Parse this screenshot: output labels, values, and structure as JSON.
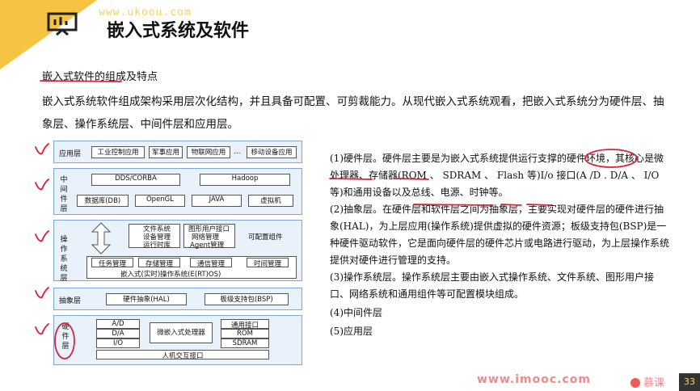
{
  "header": {
    "watermark": "www.ukoou.com",
    "title": "嵌入式系统及软件"
  },
  "subtitle": "嵌入式软件的组成及特点",
  "intro": "嵌入式系统软件组成架构采用层次化结构，并且具备可配置、可剪裁能力。从现代嵌入式系统观看，把嵌入式系统分为硬件层、抽象层、操作系统层、中间件层和应用层。",
  "diagram": {
    "app_layer": {
      "name": "应用层",
      "items": [
        "工业控制应用",
        "军事应用",
        "物联网应用",
        "…",
        "移动设备应用"
      ]
    },
    "middleware_layer": {
      "name": "中间件层",
      "top": [
        "DDS/CORBA",
        "Hadoop"
      ],
      "bottom": [
        "数据库(DB)",
        "OpenGL",
        "JAVA",
        "虚拟机"
      ]
    },
    "os_layer": {
      "name": "操作系统层",
      "col1": [
        "文件系统",
        "设备管理",
        "运行时库"
      ],
      "col2": [
        "图形用户接口",
        "网络管理",
        "Agent管理"
      ],
      "configurable": "可配置组件",
      "tasks": [
        "任务管理",
        "存储管理",
        "通信管理",
        "时间管理"
      ],
      "kernel": "嵌入式(实时)操作系统(E(RT)OS)"
    },
    "abstract_layer": {
      "name": "抽象层",
      "items": [
        "硬件抽象(HAL)",
        "板级支持包(BSP)"
      ]
    },
    "hardware_layer": {
      "name": "硬件层",
      "left": [
        "A/D",
        "D/A",
        "I/O"
      ],
      "cpu": "微嵌入式处理器",
      "right": [
        "通用接口",
        "ROM",
        "SDRAM"
      ],
      "hmi": "人机交互接口"
    }
  },
  "desc": [
    "(1)硬件层。硬件层主要是为嵌入式系统提供运行支撑的硬件环境，其核心是微处理器、存储器(ROM 、 SDRAM 、 Flash 等)I/o 接口(A /D . D/A 、 I/O 等)和通用设备以及总线、电源、时钟等。",
    "(2)抽象层。在硬件层和软件层之间为抽象层，主要实现对硬件层的硬件进行抽象(HAL)，为上层应用(操作系统)提供虚拟的硬件资源；板级支持包(BSP)是一种硬件驱动软件，它是面向硬件层的硬件芯片或电路进行驱动，为上层操作系统提供对硬件进行管理的支持。",
    "(3)操作系统层。操作系统层主要由嵌入式操作系统、文件系统、图形用户接口、网络系统和通用组件等可配置模块组成。",
    "(4)中间件层",
    "(5)应用层"
  ],
  "footer": {
    "site": "www.imooc.com",
    "brand": "慕课",
    "page": "33"
  },
  "colors": {
    "accent": "#f6c343",
    "annotation": "#d9233b",
    "layer_border": "#7fa6d6",
    "layer_fill": "#e9f1fb"
  }
}
